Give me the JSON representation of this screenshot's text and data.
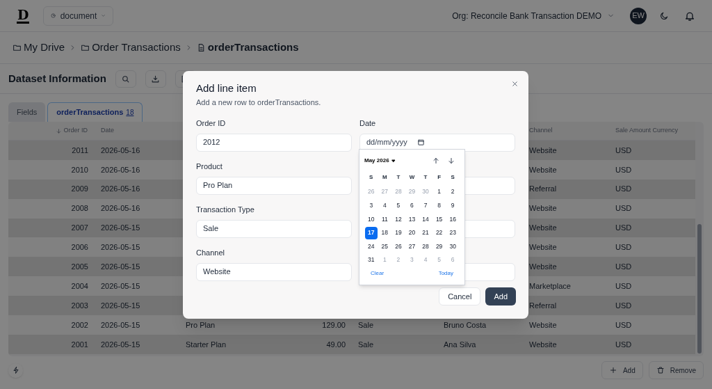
{
  "top_bar": {
    "logo": "D",
    "document_menu": "document",
    "org": "Org: Reconcile Bank Transaction DEMO",
    "avatar": "EW"
  },
  "breadcrumb": [
    {
      "label": "My Drive",
      "kind": "folder",
      "current": false
    },
    {
      "label": "Order Transactions",
      "kind": "folder",
      "current": false
    },
    {
      "label": "orderTransactions",
      "kind": "file",
      "current": true
    }
  ],
  "dataset_bar": {
    "title": "Dataset Information"
  },
  "tabs": [
    {
      "label": "Fields",
      "selected": false
    },
    {
      "label": "orderTransactions",
      "count": "18",
      "selected": true
    }
  ],
  "table": {
    "columns": [
      {
        "label": "Order ID",
        "sorted_descending": true
      },
      {
        "label": "Date"
      },
      null,
      null,
      null,
      null,
      {
        "label": "Channel"
      },
      {
        "label": "Sale Amount Currency"
      }
    ],
    "rows": [
      {
        "order_id": "2011",
        "date": "2026-05-16",
        "channel": "Website",
        "currency": "USD"
      },
      {
        "order_id": "2010",
        "date": "2026-05-16",
        "channel": "Website",
        "currency": "USD"
      },
      {
        "order_id": "2009",
        "date": "2026-05-16",
        "channel": "Referral",
        "currency": "USD"
      },
      {
        "order_id": "2008",
        "date": "2026-05-16",
        "channel": "Website",
        "currency": "USD"
      },
      {
        "order_id": "2007",
        "date": "2026-05-15",
        "channel": "Website",
        "currency": "USD"
      },
      {
        "order_id": "2006",
        "date": "2026-05-15",
        "channel": "Website",
        "currency": "USD"
      },
      {
        "order_id": "2005",
        "date": "2026-05-15",
        "channel": "Website",
        "currency": "USD"
      },
      {
        "order_id": "2004",
        "date": "2026-05-15",
        "channel": "Marketplace",
        "currency": "USD"
      },
      {
        "order_id": "2003",
        "date": "2026-05-15",
        "channel": "Referral",
        "currency": "USD"
      },
      {
        "order_id": "2002",
        "date": "2026-05-15",
        "product": "Pro Plan",
        "amount": "129.00",
        "type": "Sale",
        "customer": "Bruno Costa",
        "channel": "Website",
        "currency": "USD"
      },
      {
        "order_id": "2001",
        "date": "2026-05-15",
        "product": "Starter Plan",
        "amount": "49.00",
        "type": "Sale",
        "customer": "Ana Silva",
        "channel": "Website",
        "currency": "USD"
      }
    ]
  },
  "bottom_buttons": [
    {
      "label": "Add",
      "kind": "add"
    },
    {
      "label": "Remove",
      "kind": "remove"
    }
  ],
  "modal": {
    "title": "Add line item",
    "subtitle": "Add a new row to orderTransactions.",
    "fields": [
      {
        "kind": "text",
        "label": "Order ID",
        "value": "2012"
      },
      {
        "kind": "date",
        "label": "Date",
        "placeholder": "dd/mm/yyyy"
      },
      {
        "kind": "text",
        "label": "Product",
        "value": "Pro Plan"
      },
      {
        "kind": "covered"
      },
      {
        "kind": "text",
        "label": "Transaction Type",
        "value": "Sale"
      },
      {
        "kind": "covered"
      },
      {
        "kind": "text",
        "label": "Channel",
        "value": "Website"
      },
      {
        "kind": "covered"
      }
    ],
    "buttons": [
      {
        "label": "Cancel",
        "primary": false
      },
      {
        "label": "Add",
        "primary": true
      }
    ],
    "calendar": {
      "month": "May 2026",
      "weekdays": [
        "S",
        "M",
        "T",
        "W",
        "T",
        "F",
        "S"
      ],
      "days": [
        {
          "label": "26",
          "in_month": false,
          "selected": false
        },
        {
          "label": "27",
          "in_month": false,
          "selected": false
        },
        {
          "label": "28",
          "in_month": false,
          "selected": false
        },
        {
          "label": "29",
          "in_month": false,
          "selected": false
        },
        {
          "label": "30",
          "in_month": false,
          "selected": false
        },
        {
          "label": "1",
          "in_month": true,
          "selected": false
        },
        {
          "label": "2",
          "in_month": true,
          "selected": false
        },
        {
          "label": "3",
          "in_month": true,
          "selected": false
        },
        {
          "label": "4",
          "in_month": true,
          "selected": false
        },
        {
          "label": "5",
          "in_month": true,
          "selected": false
        },
        {
          "label": "6",
          "in_month": true,
          "selected": false
        },
        {
          "label": "7",
          "in_month": true,
          "selected": false
        },
        {
          "label": "8",
          "in_month": true,
          "selected": false
        },
        {
          "label": "9",
          "in_month": true,
          "selected": false
        },
        {
          "label": "10",
          "in_month": true,
          "selected": false
        },
        {
          "label": "11",
          "in_month": true,
          "selected": false
        },
        {
          "label": "12",
          "in_month": true,
          "selected": false
        },
        {
          "label": "13",
          "in_month": true,
          "selected": false
        },
        {
          "label": "14",
          "in_month": true,
          "selected": false
        },
        {
          "label": "15",
          "in_month": true,
          "selected": false
        },
        {
          "label": "16",
          "in_month": true,
          "selected": false
        },
        {
          "label": "17",
          "in_month": true,
          "selected": true
        },
        {
          "label": "18",
          "in_month": true,
          "selected": false
        },
        {
          "label": "19",
          "in_month": true,
          "selected": false
        },
        {
          "label": "20",
          "in_month": true,
          "selected": false
        },
        {
          "label": "21",
          "in_month": true,
          "selected": false
        },
        {
          "label": "22",
          "in_month": true,
          "selected": false
        },
        {
          "label": "23",
          "in_month": true,
          "selected": false
        },
        {
          "label": "24",
          "in_month": true,
          "selected": false
        },
        {
          "label": "25",
          "in_month": true,
          "selected": false
        },
        {
          "label": "26",
          "in_month": true,
          "selected": false
        },
        {
          "label": "27",
          "in_month": true,
          "selected": false
        },
        {
          "label": "28",
          "in_month": true,
          "selected": false
        },
        {
          "label": "29",
          "in_month": true,
          "selected": false
        },
        {
          "label": "30",
          "in_month": true,
          "selected": false
        },
        {
          "label": "31",
          "in_month": true,
          "selected": false
        },
        {
          "label": "1",
          "in_month": false,
          "selected": false
        },
        {
          "label": "2",
          "in_month": false,
          "selected": false
        },
        {
          "label": "3",
          "in_month": false,
          "selected": false
        },
        {
          "label": "4",
          "in_month": false,
          "selected": false
        },
        {
          "label": "5",
          "in_month": false,
          "selected": false
        },
        {
          "label": "6",
          "in_month": false,
          "selected": false
        }
      ],
      "clear": "Clear",
      "today": "Today"
    }
  }
}
